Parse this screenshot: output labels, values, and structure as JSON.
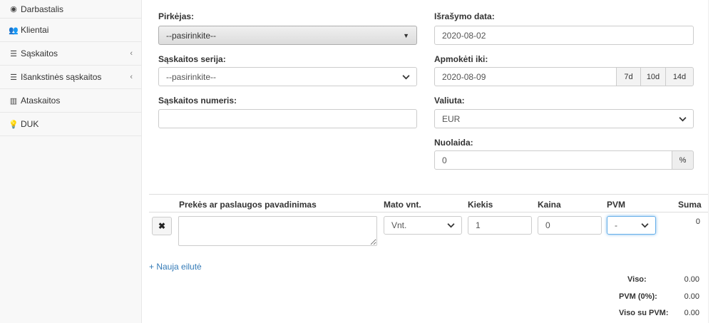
{
  "sidebar": {
    "items": [
      {
        "label": "Darbastalis",
        "icon": "dashboard-icon",
        "glyph": "◉",
        "has_chevron": false
      },
      {
        "label": "Klientai",
        "icon": "users-icon",
        "glyph": "👥",
        "has_chevron": false
      },
      {
        "label": "Sąskaitos",
        "icon": "list-icon",
        "glyph": "☰",
        "has_chevron": true
      },
      {
        "label": "Išankstinės sąskaitos",
        "icon": "list-icon",
        "glyph": "☰",
        "has_chevron": true
      },
      {
        "label": "Ataskaitos",
        "icon": "bar-chart-icon",
        "glyph": "▥",
        "has_chevron": false
      },
      {
        "label": "DUK",
        "icon": "lightbulb-icon",
        "glyph": "💡",
        "has_chevron": false
      }
    ],
    "chevron_glyph": "‹"
  },
  "form": {
    "buyer_label": "Pirkėjas:",
    "buyer_value": "--pasirinkite--",
    "series_label": "Sąskaitos serija:",
    "series_value": "--pasirinkite--",
    "number_label": "Sąskaitos numeris:",
    "number_value": "",
    "issue_date_label": "Išrašymo data:",
    "issue_date_value": "2020-08-02",
    "due_label": "Apmokėti iki:",
    "due_value": "2020-08-09",
    "due_buttons": [
      "7d",
      "10d",
      "14d"
    ],
    "currency_label": "Valiuta:",
    "currency_value": "EUR",
    "discount_label": "Nuolaida:",
    "discount_value": "0",
    "discount_addon": "%"
  },
  "table": {
    "headers": {
      "name": "Prekės ar paslaugos pavadinimas",
      "unit": "Mato vnt.",
      "qty": "Kiekis",
      "price": "Kaina",
      "vat": "PVM",
      "sum": "Suma"
    },
    "row": {
      "delete_glyph": "✖",
      "name": "",
      "unit": "Vnt.",
      "qty": "1",
      "price": "0",
      "vat": "-",
      "sum": "0"
    },
    "new_row_link": "+ Nauja eilutė"
  },
  "totals": {
    "viso_label": "Viso:",
    "viso_value": "0.00",
    "pvm_label": "PVM (0%):",
    "pvm_value": "0.00",
    "viso_su_pvm_label": "Viso su PVM:",
    "viso_su_pvm_value": "0.00"
  },
  "colors": {
    "accent": "#337ab7",
    "focus": "#66afe9"
  }
}
